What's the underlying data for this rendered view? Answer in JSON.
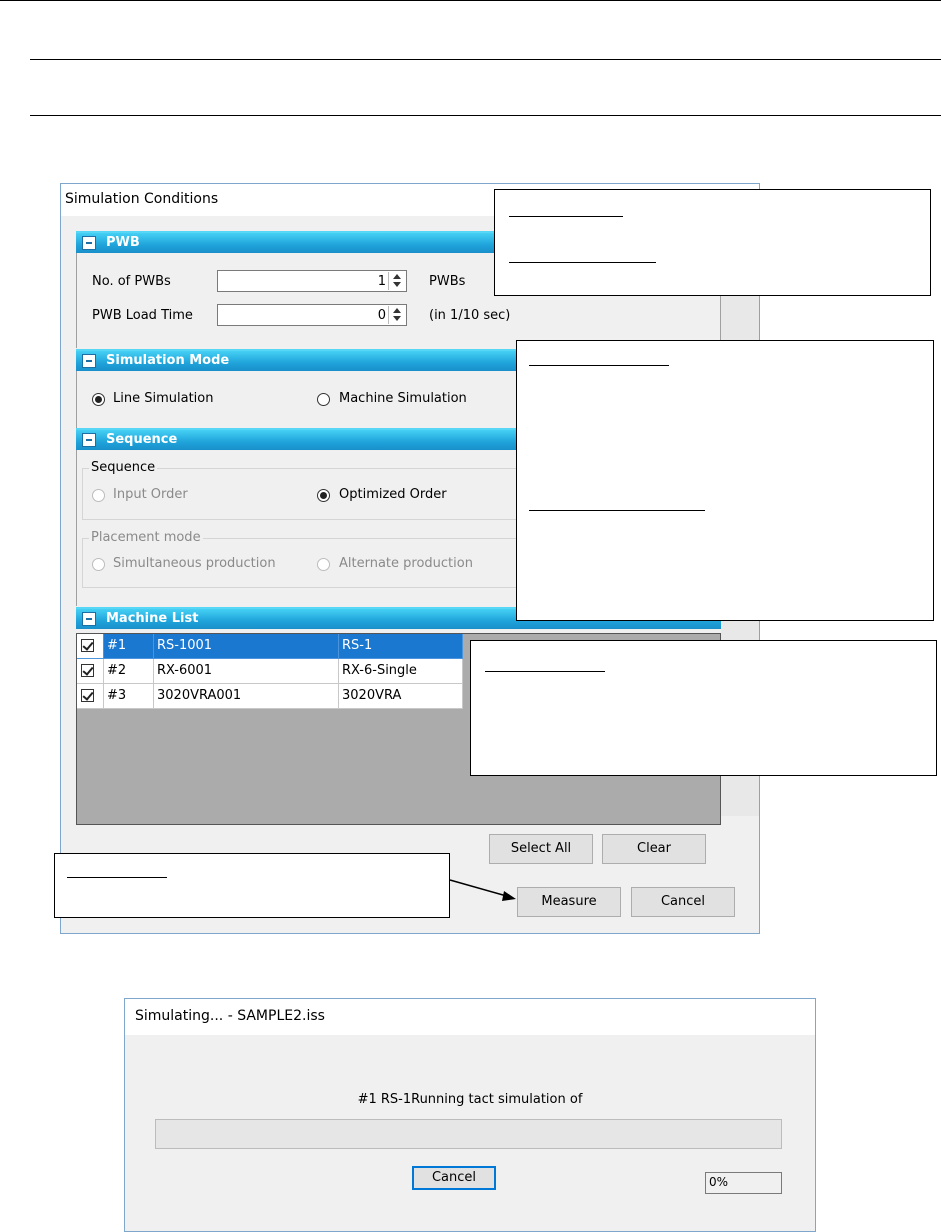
{
  "simulation_conditions": {
    "title": "Simulation Conditions",
    "pwb": {
      "section_title": "PWB",
      "no_of_pwbs_label": "No. of PWBs",
      "no_of_pwbs_value": "1",
      "no_of_pwbs_unit": "PWBs",
      "load_time_label": "PWB Load Time",
      "load_time_value": "0",
      "load_time_unit": "(in 1/10 sec)"
    },
    "simulation_mode": {
      "section_title": "Simulation Mode",
      "line_label": "Line Simulation",
      "machine_label": "Machine Simulation",
      "selected": "Line Simulation"
    },
    "sequence": {
      "section_title": "Sequence",
      "group_label": "Sequence",
      "input_order_label": "Input Order",
      "optimized_order_label": "Optimized Order",
      "selected": "Optimized Order",
      "placement_group_label": "Placement mode",
      "simultaneous_label": "Simultaneous production",
      "alternate_label": "Alternate production"
    },
    "machine_list": {
      "section_title": "Machine List",
      "rows": [
        {
          "num": "#1",
          "name": "RS-1001",
          "model": "RS-1",
          "checked": true,
          "selected": true
        },
        {
          "num": "#2",
          "name": "RX-6001",
          "model": "RX-6-Single",
          "checked": true,
          "selected": false
        },
        {
          "num": "#3",
          "name": "3020VRA001",
          "model": "3020VRA",
          "checked": true,
          "selected": false
        }
      ]
    },
    "buttons": {
      "select_all": "Select All",
      "clear": "Clear",
      "measure": "Measure",
      "cancel": "Cancel"
    }
  },
  "simulating_dialog": {
    "title": "Simulating... - SAMPLE2.iss",
    "message": "#1 RS-1Running tact simulation of",
    "progress_fraction": 0,
    "cancel_label": "Cancel",
    "percent_text": "0%"
  },
  "colors": {
    "section_bar": "#1fa3da",
    "selection": "#1a78d0",
    "window_border": "#7fa7cc",
    "focus_border": "#0078d7"
  }
}
